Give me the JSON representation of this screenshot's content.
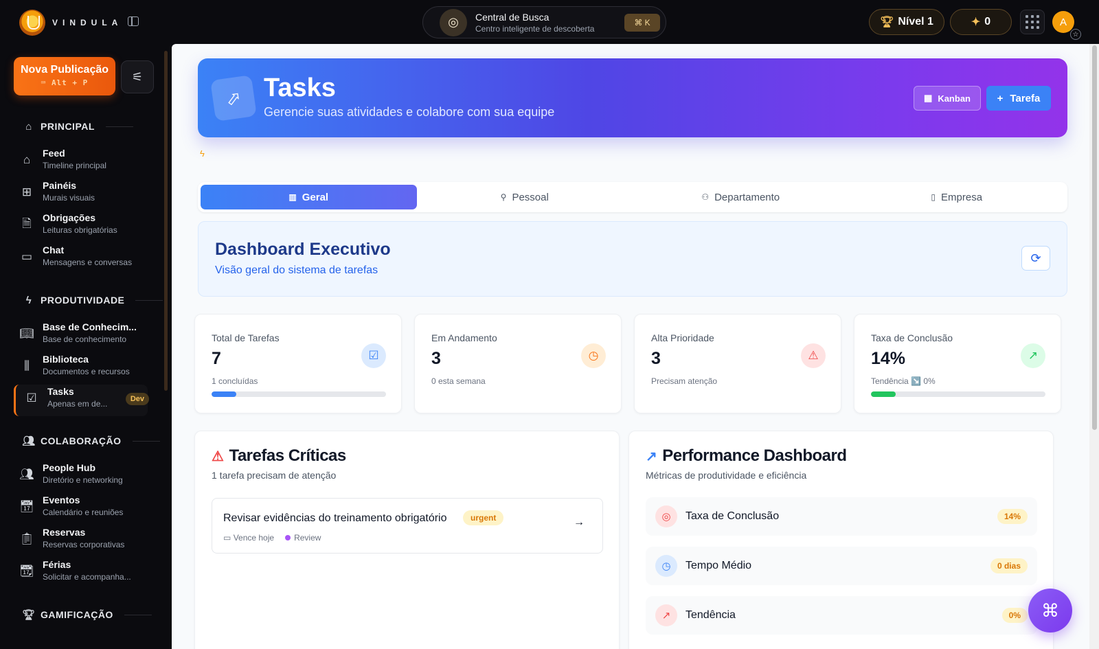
{
  "topbar": {
    "logo_text": "VINDULA",
    "search_title": "Central de Busca",
    "search_subtitle": "Centro inteligente de descoberta",
    "search_shortcut": "⌘ K",
    "level_label": "Nível 1",
    "points": "0",
    "avatar_initial": "A"
  },
  "sidebar": {
    "new_post_label": "Nova Publicação",
    "new_post_shortcut": "Alt + P",
    "sections": {
      "principal": "PRINCIPAL",
      "produtividade": "PRODUTIVIDADE",
      "colaboracao": "COLABORAÇÃO",
      "gamificacao": "GAMIFICAÇÃO"
    },
    "items": [
      {
        "title": "Feed",
        "subtitle": "Timeline principal"
      },
      {
        "title": "Painéis",
        "subtitle": "Murais visuais"
      },
      {
        "title": "Obrigações",
        "subtitle": "Leituras obrigatórias"
      },
      {
        "title": "Chat",
        "subtitle": "Mensagens e conversas"
      },
      {
        "title": "Base de Conhecim...",
        "subtitle": "Base de conhecimento"
      },
      {
        "title": "Biblioteca",
        "subtitle": "Documentos e recursos"
      },
      {
        "title": "Tasks",
        "subtitle": "Apenas em de...",
        "badge": "Dev"
      },
      {
        "title": "People Hub",
        "subtitle": "Diretório e networking"
      },
      {
        "title": "Eventos",
        "subtitle": "Calendário e reuniões"
      },
      {
        "title": "Reservas",
        "subtitle": "Reservas corporativas"
      },
      {
        "title": "Férias",
        "subtitle": "Solicitar e acompanha..."
      }
    ]
  },
  "hero": {
    "title": "Tasks",
    "subtitle": "Gerencie suas atividades e colabore com sua equipe",
    "kanban_label": "Kanban",
    "new_task_label": "Tarefa"
  },
  "tabs": [
    "Geral",
    "Pessoal",
    "Departamento",
    "Empresa"
  ],
  "dashboard": {
    "title": "Dashboard Executivo",
    "subtitle": "Visão geral do sistema de tarefas"
  },
  "stats": [
    {
      "label": "Total de Tarefas",
      "value": "7",
      "note": "1 concluídas",
      "progress": 0.14,
      "color": "#3b82f6"
    },
    {
      "label": "Em Andamento",
      "value": "3",
      "note": "0 esta semana",
      "color": "#f97316"
    },
    {
      "label": "Alta Prioridade",
      "value": "3",
      "note": "Precisam atenção",
      "color": "#ef4444"
    },
    {
      "label": "Taxa de Conclusão",
      "value": "14%",
      "note": "Tendência ↘️ 0%",
      "progress": 0.14,
      "color": "#22c55e"
    }
  ],
  "critical": {
    "title": "Tarefas Críticas",
    "subtitle": "1 tarefa precisam de atenção",
    "task": {
      "title": "Revisar evidências do treinamento obrigatório",
      "priority": "urgent",
      "due": "Vence hoje",
      "status": "Review"
    }
  },
  "performance": {
    "title": "Performance Dashboard",
    "subtitle": "Métricas de produtividade e eficiência",
    "rows": [
      {
        "label": "Taxa de Conclusão",
        "value": "14%"
      },
      {
        "label": "Tempo Médio",
        "value": "0 dias"
      },
      {
        "label": "Tendência",
        "value": "0%"
      }
    ]
  },
  "colors": {
    "accent": "#f97316",
    "primary": "#3b82f6",
    "purple": "#7c3aed"
  }
}
